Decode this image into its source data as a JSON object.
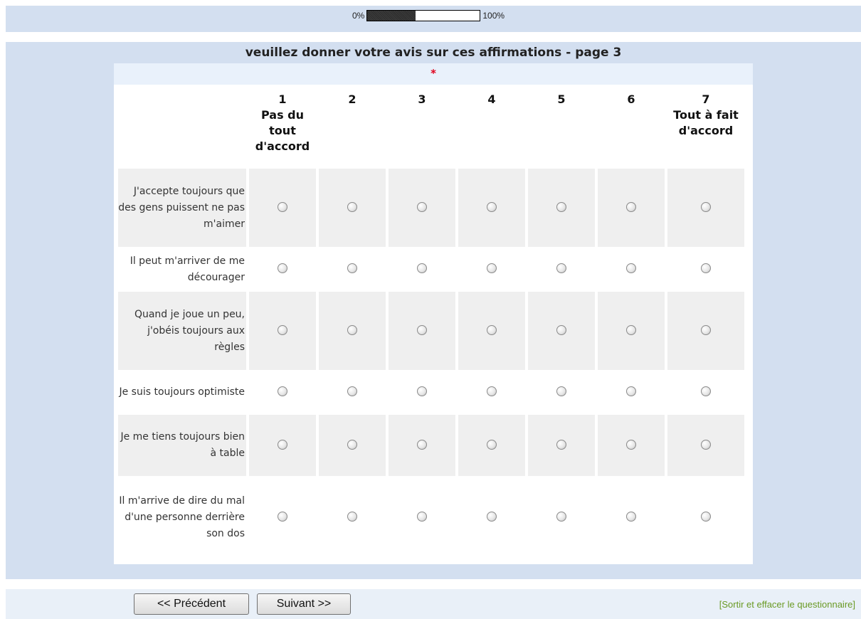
{
  "progress": {
    "start_label": "0%",
    "end_label": "100%",
    "fraction": 0.43
  },
  "survey": {
    "title": "veuillez donner votre avis sur ces affirmations - page 3",
    "required_marker": "*",
    "scale": [
      "1",
      "2",
      "3",
      "4",
      "5",
      "6",
      "7"
    ],
    "scale_low_label": "Pas du tout d'accord",
    "scale_high_label": "Tout à fait d'accord",
    "statements": [
      "J'accepte toujours que des gens puissent ne pas m'aimer",
      "Il peut m'arriver de me décourager",
      "Quand je joue un peu, j'obéis toujours aux règles",
      "Je suis toujours optimiste",
      "Je me tiens toujours bien à table",
      "Il m'arrive de dire du mal d'une personne derrière son dos"
    ]
  },
  "nav": {
    "prev_label": "<< Précédent",
    "next_label": "Suivant >>",
    "exit_label": "[Sortir et effacer le questionnaire]"
  },
  "colors": {
    "panel": "#d3dff0",
    "row_alt": "#efefef",
    "required": "#e0001b",
    "exit_link": "#6a9a24"
  }
}
